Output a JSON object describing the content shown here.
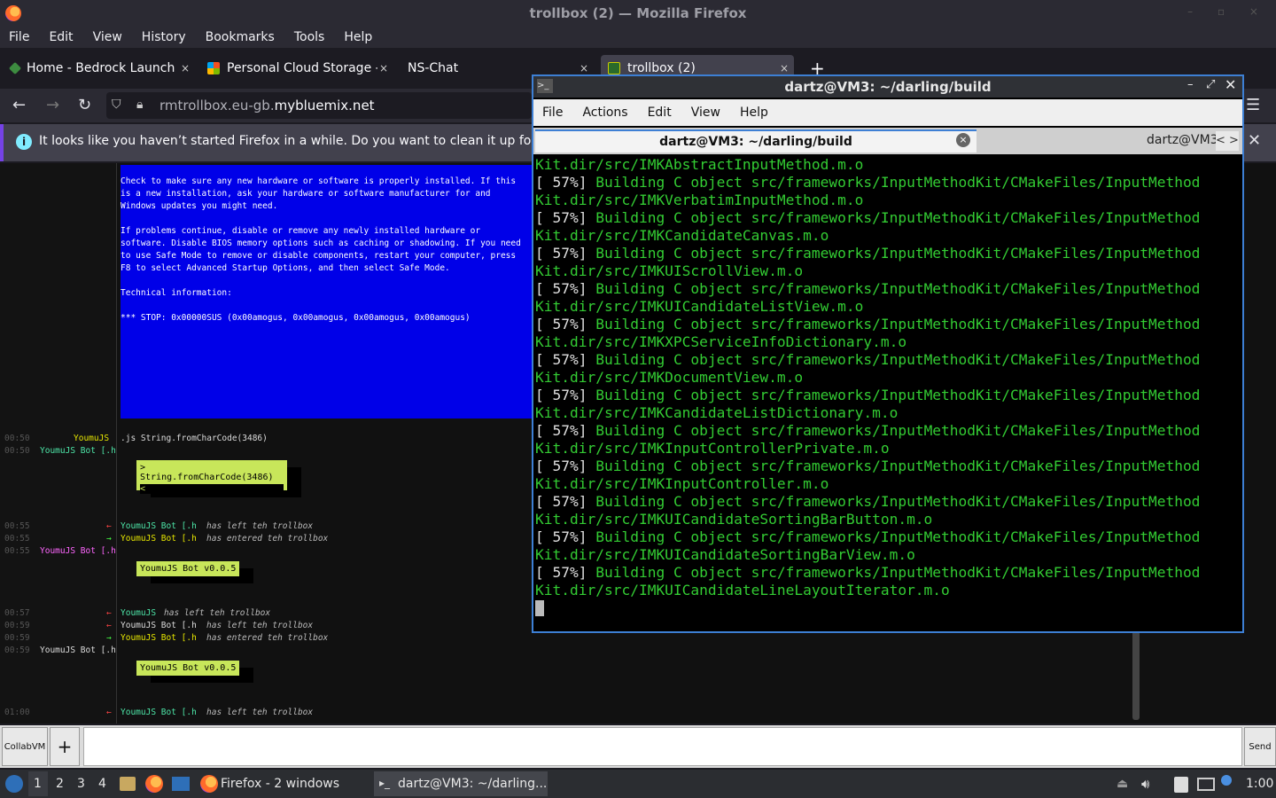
{
  "window": {
    "title": "trollbox (2) — Mozilla Firefox"
  },
  "menubar": [
    "File",
    "Edit",
    "View",
    "History",
    "Bookmarks",
    "Tools",
    "Help"
  ],
  "tabs": [
    {
      "label": "Home - Bedrock Launche",
      "close": "×"
    },
    {
      "label": "Personal Cloud Storage -",
      "close": "×"
    },
    {
      "label": "NS-Chat",
      "close": "×"
    },
    {
      "label": "trollbox (2)",
      "close": "×"
    }
  ],
  "new_tab": "+",
  "url": {
    "prefix": "rmtrollbox.eu-gb.",
    "domain": "mybluemix.net"
  },
  "notification": "It looks like you haven’t started Firefox in a while. Do you want to clean it up for a f",
  "bsod_text": "Check to make sure any new hardware or software is properly installed. If this\nis a new installation, ask your hardware or software manufacturer for and\nWindows updates you might need.\n\nIf problems continue, disable or remove any newly installed hardware or\nsoftware. Disable BIOS memory options such as caching or shadowing. If you need\nto use Safe Mode to remove or disable components, restart your computer, press\nF8 to select Advanced Startup Options, and then select Safe Mode.\n\nTechnical information:\n\n*** STOP: 0x00000SUS (0x00amogus, 0x00amogus, 0x00amogus, 0x00amogus)",
  "chat": {
    "l1_ts": "00:50",
    "l1_nick": "YoumuJS",
    "l1_msg": ".js String.fromCharCode(3486)",
    "l2_ts": "00:50",
    "l2_nick": "YoumuJS Bot [.h",
    "box1_line1": "> String.fromCharCode(3486)",
    "box1_line2": "<",
    "l3_ts": "00:55",
    "l3_arrow": "←",
    "l3_nick": "YoumuJS Bot [.h",
    "l3_msg": "has left teh trollbox",
    "l4_ts": "00:55",
    "l4_arrow": "→",
    "l4_nick": "YoumuJS Bot [.h",
    "l4_msg": "has entered teh trollbox",
    "l5_ts": "00:55",
    "l5_nick": "YoumuJS Bot [.h",
    "box2": "YoumuJS Bot v0.0.5",
    "l6_ts": "00:57",
    "l6_arrow": "←",
    "l6_nick": "YoumuJS",
    "l6_msg": "has left teh trollbox",
    "l7_ts": "00:59",
    "l7_arrow": "←",
    "l7_nick": "YoumuJS Bot [.h",
    "l7_msg": "has left teh trollbox",
    "l8_ts": "00:59",
    "l8_arrow": "→",
    "l8_nick": "YoumuJS Bot [.h",
    "l8_msg": "has entered teh trollbox",
    "l9_ts": "00:59",
    "l9_nick": "YoumuJS Bot [.h",
    "box3": "YoumuJS Bot v0.0.5",
    "l10_ts": "01:00",
    "l10_arrow": "←",
    "l10_nick": "YoumuJS Bot [.h",
    "l10_msg": "has left teh trollbox"
  },
  "chat_controls": {
    "collab": "CollabVM",
    "plus": "+",
    "send": "Send"
  },
  "terminal": {
    "title": "dartz@VM3: ~/darling/build",
    "menu": [
      "File",
      "Actions",
      "Edit",
      "View",
      "Help"
    ],
    "tab_active": "dartz@VM3: ~/darling/build",
    "tab_close": "×",
    "tab_other": "dartz@VM3",
    "tab_arrows": "< >",
    "first_line": "Kit.dir/src/IMKAbstractInputMethod.m.o",
    "pct": "[ 57%]",
    "build_prefix": " Building C object src/frameworks/InputMethodKit/CMakeFiles/InputMethod",
    "objects": [
      "Kit.dir/src/IMKVerbatimInputMethod.m.o",
      "Kit.dir/src/IMKCandidateCanvas.m.o",
      "Kit.dir/src/IMKUIScrollView.m.o",
      "Kit.dir/src/IMKUICandidateListView.m.o",
      "Kit.dir/src/IMKXPCServiceInfoDictionary.m.o",
      "Kit.dir/src/IMKDocumentView.m.o",
      "Kit.dir/src/IMKCandidateListDictionary.m.o",
      "Kit.dir/src/IMKInputControllerPrivate.m.o",
      "Kit.dir/src/IMKInputController.m.o",
      "Kit.dir/src/IMKUICandidateSortingBarButton.m.o",
      "Kit.dir/src/IMKUICandidateSortingBarView.m.o",
      "Kit.dir/src/IMKUICandidateLineLayoutIterator.m.o"
    ]
  },
  "taskbar": {
    "workspaces": [
      "1",
      "2",
      "3",
      "4"
    ],
    "firefox_label": "Firefox - 2 windows",
    "terminal_label": "dartz@VM3: ~/darling...",
    "clock": "1:00"
  }
}
